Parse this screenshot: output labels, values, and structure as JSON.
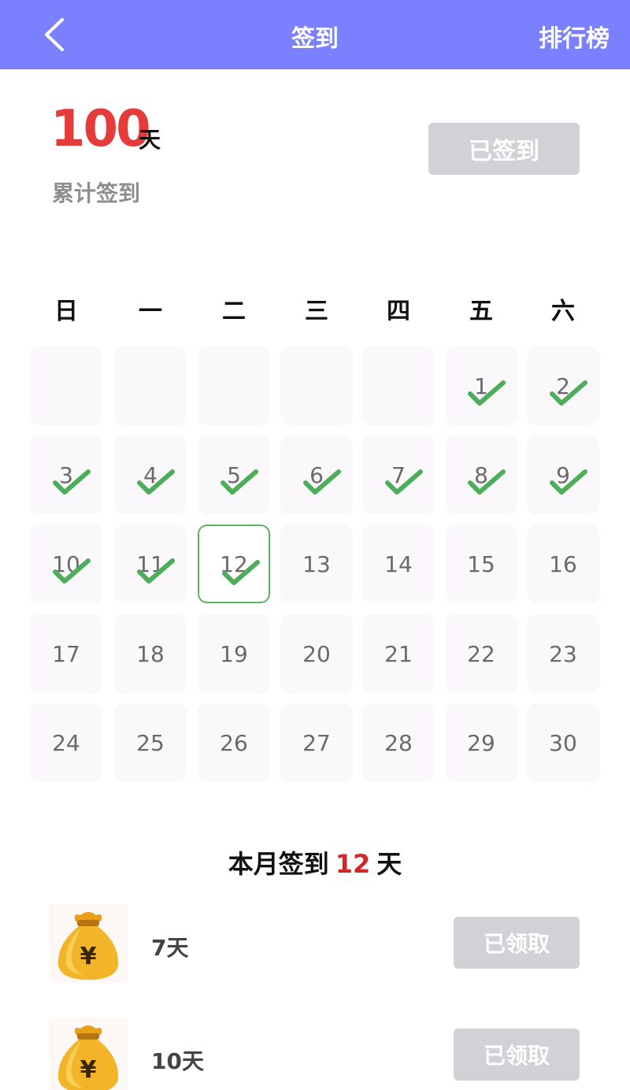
{
  "header": {
    "back_icon": "chevron-left-icon",
    "title": "签到",
    "rank_label": "排行榜",
    "background": "#7b80ff"
  },
  "summary": {
    "total_days": "100",
    "unit": "天",
    "label": "累计签到",
    "button_label": "已签到"
  },
  "calendar": {
    "weekdays": [
      "日",
      "一",
      "二",
      "三",
      "四",
      "五",
      "六"
    ],
    "leading_blank_days": 5,
    "days": [
      "1",
      "2",
      "3",
      "4",
      "5",
      "6",
      "7",
      "8",
      "9",
      "10",
      "11",
      "12",
      "13",
      "14",
      "15",
      "16",
      "17",
      "18",
      "19",
      "20",
      "21",
      "22",
      "23",
      "24",
      "25",
      "26",
      "27",
      "28",
      "29",
      "30"
    ],
    "signed_days": [
      1,
      2,
      3,
      4,
      5,
      6,
      7,
      8,
      9,
      10,
      11,
      12
    ],
    "today": 12,
    "check_icon": "checkmark-icon",
    "check_color": "#4cae5a"
  },
  "month_summary": {
    "prefix": "本月签到",
    "count": "12",
    "suffix": "天"
  },
  "rewards": [
    {
      "days_label": "7天",
      "button_label": "已领取",
      "icon": "money-bag-icon"
    },
    {
      "days_label": "10天",
      "button_label": "已领取",
      "icon": "money-bag-icon"
    }
  ]
}
